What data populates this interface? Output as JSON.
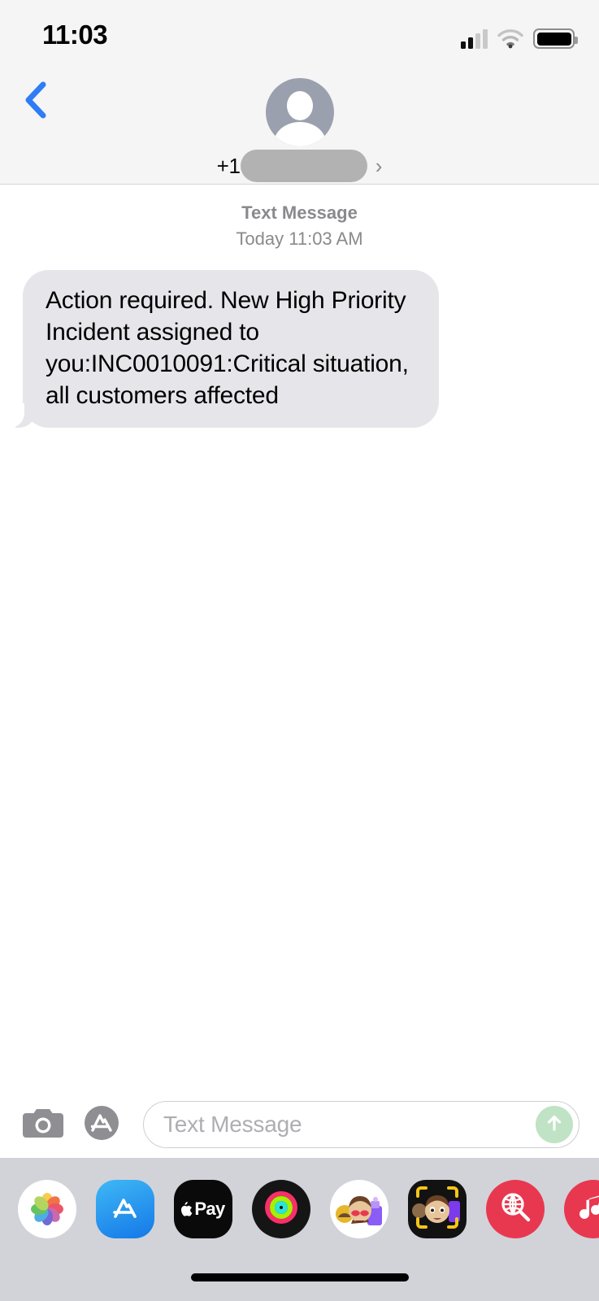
{
  "statusbar": {
    "time": "11:03",
    "signal_icon": "cellular-signal-icon",
    "signal_bars_filled": 2,
    "signal_bars_total": 4,
    "wifi_icon": "wifi-icon",
    "battery_icon": "battery-full-icon",
    "battery_level_percent": 100
  },
  "navbar": {
    "back_icon": "chevron-left-icon",
    "avatar_icon": "contact-avatar-placeholder-icon",
    "contact_prefix": "+1",
    "contact_number_redacted": "",
    "detail_chevron": "›"
  },
  "conversation": {
    "service_label": "Text Message",
    "timestamp": "Today 11:03 AM",
    "messages": [
      {
        "sender": "incoming",
        "text": "Action required. New High Priority Incident assigned to you:INC0010091:Critical situation, all customers affected"
      }
    ]
  },
  "toolbar": {
    "camera_icon": "camera-icon",
    "appstore_icon": "app-store-icon",
    "input_placeholder": "Text Message",
    "input_value": "",
    "send_icon": "send-arrow-up-icon"
  },
  "drawer": {
    "apps": [
      {
        "name": "photos-app",
        "icon": "photos-icon",
        "bg": "#ffffff"
      },
      {
        "name": "app-store-app",
        "icon": "app-store-icon",
        "bg": "#1d9bf6"
      },
      {
        "name": "apple-pay-app",
        "icon": "apple-pay-icon",
        "bg": "#000000",
        "label": "Pay"
      },
      {
        "name": "fitness-app",
        "icon": "activity-rings-icon",
        "bg": "#151515"
      },
      {
        "name": "memoji-stickers-app",
        "icon": "memoji-stickers-icon",
        "bg": "#ffffff"
      },
      {
        "name": "memoji-app",
        "icon": "memoji-icon",
        "bg": "#121212"
      },
      {
        "name": "images-app",
        "icon": "globe-search-icon",
        "bg": "#e8384f"
      },
      {
        "name": "music-app",
        "icon": "music-note-icon",
        "bg": "#e8384f"
      }
    ],
    "home_indicator": "home-indicator"
  },
  "colors": {
    "ios_blue": "#2e7cf6",
    "bubble_gray": "#e6e5ea",
    "chrome_gray": "#f5f5f5",
    "drawer_gray": "#d1d3d9",
    "send_green": "#bfe3c4",
    "muted_text": "#8a8a8e"
  }
}
